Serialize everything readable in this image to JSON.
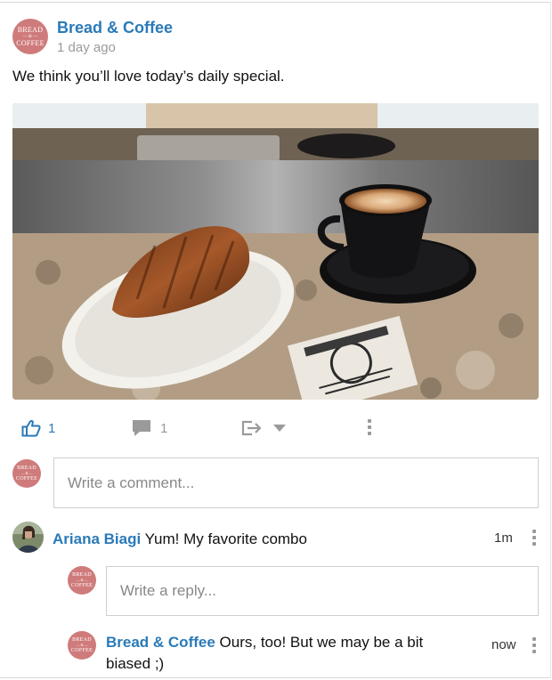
{
  "post": {
    "author": "Bread & Coffee",
    "avatar_text": [
      "BREAD",
      "— & —",
      "COFFEE"
    ],
    "time": "1 day ago",
    "text": "We think you’ll love today’s daily special.",
    "image_icon": "croissant-and-latte-photo"
  },
  "actions": {
    "like_count": "1",
    "comment_count": "1",
    "like_icon": "thumbs-up-icon",
    "comment_icon": "comment-icon",
    "share_icon": "share-icon",
    "more_icon": "more-vertical-icon"
  },
  "comment_input": {
    "placeholder": "Write a comment..."
  },
  "comment": {
    "author": "Ariana Biagi",
    "text": "Yum! My favorite combo",
    "time": "1m"
  },
  "reply_input": {
    "placeholder": "Write a reply..."
  },
  "reply": {
    "author": "Bread & Coffee",
    "text": "Ours, too! But we may be a bit biased ;)",
    "time": "now"
  },
  "colors": {
    "link": "#2a7ab8",
    "brand_avatar": "#cf7b7b",
    "muted": "#9a9a9a"
  }
}
